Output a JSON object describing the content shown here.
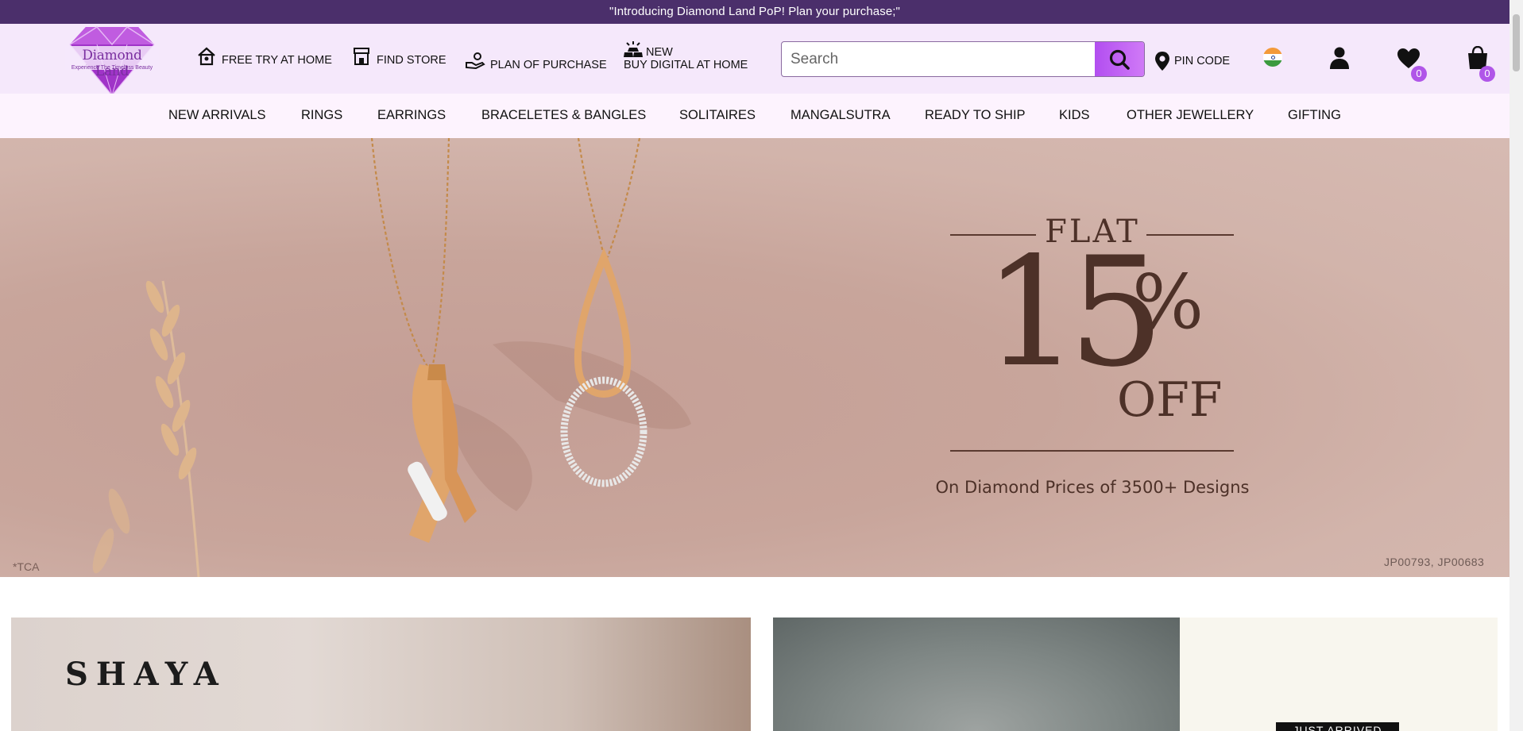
{
  "announcement": "\"Introducing Diamond Land PoP! Plan your purchase;\"",
  "logo": {
    "brand": "Diamond Land",
    "tagline": "Experience The Timeless Beauty"
  },
  "header_links": [
    {
      "label": "FREE TRY AT HOME",
      "icon": "home-icon"
    },
    {
      "label": "FIND STORE",
      "icon": "store-icon"
    },
    {
      "label": "PLAN OF PURCHASE",
      "icon": "hand-coin-icon"
    },
    {
      "label_top": "NEW",
      "label": "BUY DIGITAL AT HOME",
      "icon": "digital-gold-icon"
    }
  ],
  "search": {
    "placeholder": "Search"
  },
  "pin_code": "PIN CODE",
  "wishlist_count": "0",
  "cart_count": "0",
  "nav": [
    "NEW ARRIVALS",
    "RINGS",
    "EARRINGS",
    "BRACELETES & BANGLES",
    "SOLITAIRES",
    "MANGALSUTRA",
    "READY TO SHIP",
    "KIDS",
    "OTHER JEWELLERY",
    "GIFTING"
  ],
  "hero": {
    "flat": "FLAT",
    "number": "15",
    "percent": "%",
    "off": "OFF",
    "subtitle": "On Diamond Prices of 3500+ Designs",
    "disclaimer": "*TCA",
    "codes": "JP00793, JP00683"
  },
  "cards": {
    "shaya": "SHAYA",
    "just_arrived": "JUST ARRIVED"
  },
  "colors": {
    "announce_bg": "#4b2f6b",
    "header_bg": "#f5e8fb",
    "accent": "#b24ef0"
  }
}
